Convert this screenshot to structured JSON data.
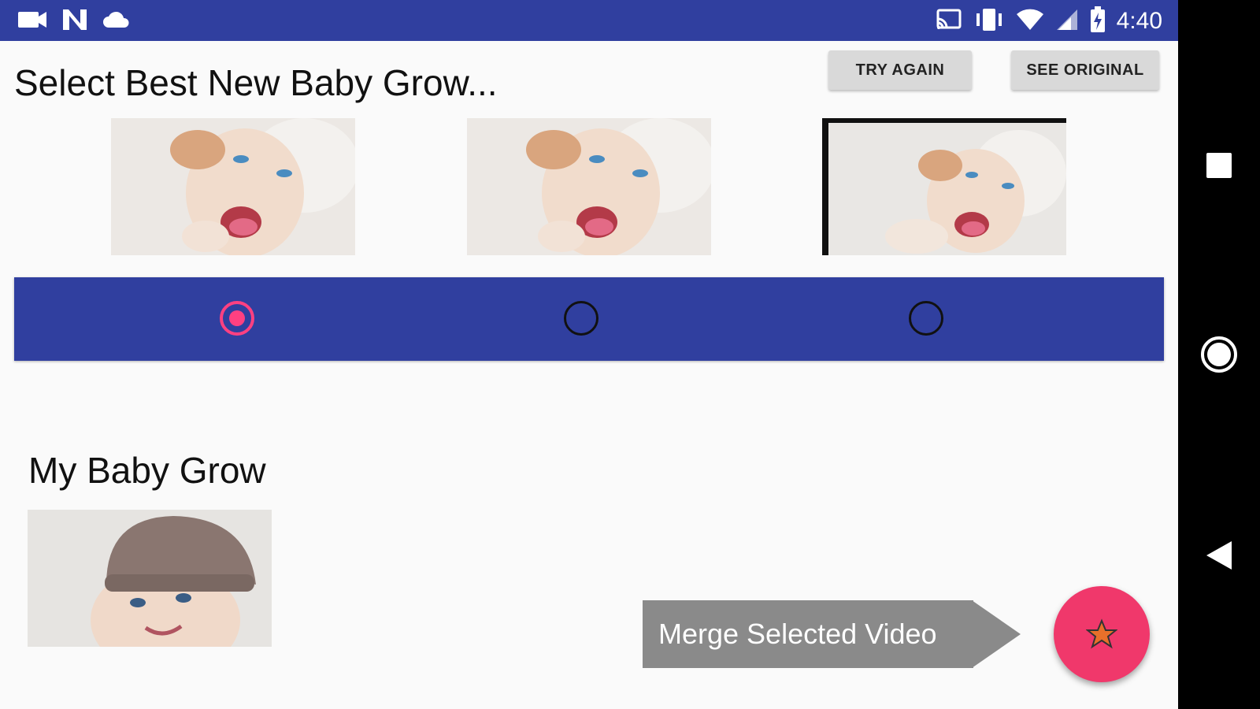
{
  "status_bar": {
    "time": "4:40",
    "left_icons": [
      "video-camera-icon",
      "n-icon",
      "cloud-icon"
    ],
    "right_icons": [
      "cast-icon",
      "vibrate-icon",
      "wifi-icon",
      "signal-icon",
      "battery-charging-icon"
    ]
  },
  "header": {
    "title": "Select Best New Baby Grow...",
    "try_again_label": "TRY AGAIN",
    "see_original_label": "SEE ORIGINAL"
  },
  "options": {
    "selected_index": 0,
    "items": [
      {
        "image": "baby-photo-icon",
        "selected": true
      },
      {
        "image": "baby-photo-icon",
        "selected": false
      },
      {
        "image": "baby-photo-icon",
        "selected": false
      }
    ]
  },
  "my_grow": {
    "title": "My Baby Grow",
    "image": "baby-photo-icon"
  },
  "fab": {
    "tooltip": "Merge Selected Video",
    "icon": "star-icon"
  },
  "nav": {
    "buttons": [
      "recents-icon",
      "home-icon",
      "back-icon"
    ]
  },
  "colors": {
    "primary": "#303f9f",
    "accent": "#ff4081",
    "fab": "#f0386b",
    "tooltip_bg": "#8a8a8a",
    "button_bg": "#d9d9d9"
  }
}
